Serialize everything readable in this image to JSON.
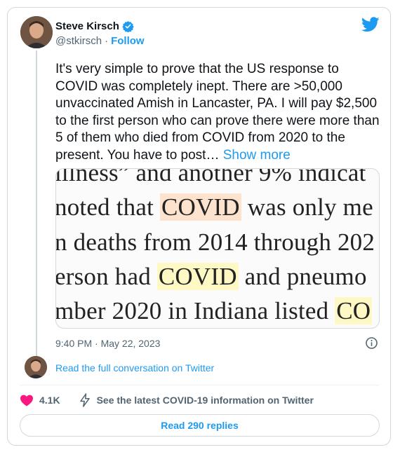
{
  "author": {
    "name": "Steve Kirsch",
    "handle": "@stkirsch",
    "separator": "·",
    "follow_label": "Follow"
  },
  "tweet": {
    "text": "It's very simple to prove that the US response to COVID was completely inept. There are >50,000 unvaccinated Amish in Lancaster, PA. I will pay $2,500 to the first person who can prove there were more than 5 of them who died from COVID from 2020 to the present. You have to post…",
    "show_more": "Show more"
  },
  "media": {
    "lines": [
      {
        "pre": "illness” and another 9% indicat",
        "hl": "",
        "post": ""
      },
      {
        "pre": "noted that ",
        "hl": "COVID",
        "post": " was only me"
      },
      {
        "pre": "n deaths from 2014 through 202",
        "hl": "",
        "post": ""
      },
      {
        "pre": "erson had ",
        "hl": "COVID",
        "post": " and pneumo"
      },
      {
        "pre": "mber 2020 in Indiana listed ",
        "hl": "CO",
        "post": ""
      }
    ]
  },
  "meta": {
    "time": "9:40 PM · May 22, 2023"
  },
  "conversation_link": "Read the full conversation on Twitter",
  "actions": {
    "likes": "4.1K",
    "covid_info": "See the latest COVID-19 information on Twitter"
  },
  "replies_button": "Read 290 replies",
  "colors": {
    "accent": "#1d9bf0",
    "like": "#f91880",
    "secondary_text": "#536471",
    "border": "#cfd9de"
  },
  "icons": [
    "verified-badge-icon",
    "twitter-bird-icon",
    "info-icon",
    "heart-icon",
    "lightning-icon"
  ]
}
